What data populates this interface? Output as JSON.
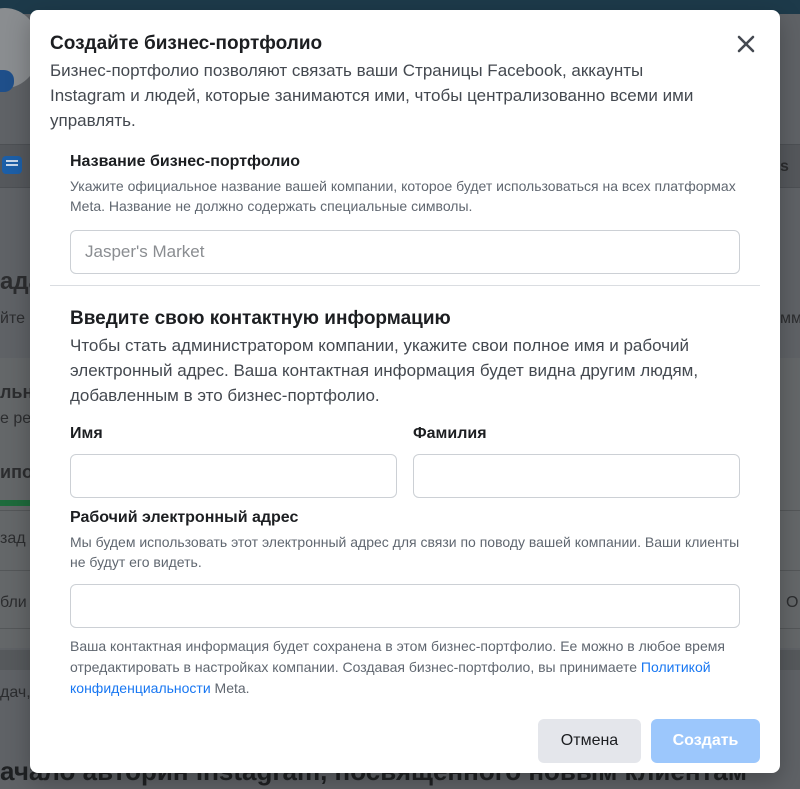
{
  "modal": {
    "title": "Создайте бизнес-портфолио",
    "description": "Бизнес-портфолио позволяют связать ваши Страницы Facebook, аккаунты Instagram и людей, которые занимаются ими, чтобы централизованно всеми ими управлять.",
    "close_icon": "close-icon"
  },
  "business_name": {
    "label": "Название бизнес-портфолио",
    "help": "Укажите официальное название вашей компании, которое будет использоваться на всех платформах Meta. Название не должно содержать специальные символы.",
    "placeholder": "Jasper's Market",
    "value": ""
  },
  "contact": {
    "title": "Введите свою контактную информацию",
    "description": "Чтобы стать администратором компании, укажите свои полное имя и рабочий электронный адрес. Ваша контактная информация будет видна другим людям, добавленным в это бизнес-портфолио.",
    "first_name_label": "Имя",
    "first_name_value": "",
    "last_name_label": "Фамилия",
    "last_name_value": "",
    "email_label": "Рабочий электронный адрес",
    "email_help": "Мы будем использовать этот электронный адрес для связи по поводу вашей компании. Ваши клиенты не будут его видеть.",
    "email_value": ""
  },
  "footnote": {
    "text_before": "Ваша контактная информация будет сохранена в этом бизнес-портфолио. Ее можно в любое время отредактировать в настройках компании. Создавая бизнес-портфолио, вы принимаете ",
    "link": "Политикой конфиденциальности",
    "text_after": " Meta."
  },
  "buttons": {
    "cancel": "Отмена",
    "create": "Создать"
  },
  "background": {
    "fragments": [
      "s",
      "ада",
      "йте",
      "мма",
      "льн",
      "е ре",
      "ипо",
      "зад",
      "бли",
      "О",
      "дач,",
      "ачало авторин instagram, посвященного новым клиентам"
    ]
  },
  "colors": {
    "link": "#1877f2",
    "primary_disabled": "#9cc7fc",
    "secondary": "#e4e6eb"
  }
}
